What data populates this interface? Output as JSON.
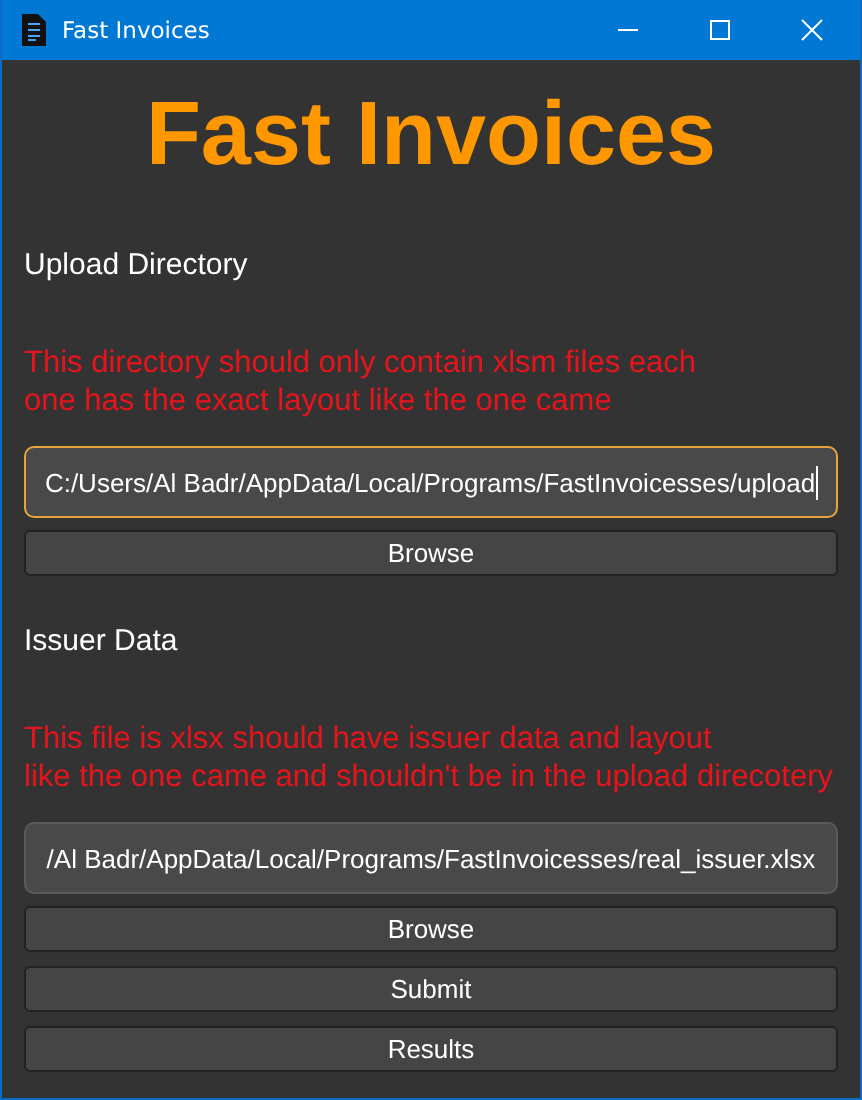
{
  "window": {
    "title": "Fast Invoices"
  },
  "heading": "Fast Invoices",
  "sections": [
    {
      "label": "Upload Directory",
      "note": "This directory should only contain xlsm files each\none has the exact layout like the one came",
      "field": {
        "value": "C:/Users/Al Badr/AppData/Local/Programs/FastInvoicesses/upload",
        "focused": true
      },
      "buttons": [
        "Browse"
      ]
    },
    {
      "label": "Issuer Data",
      "note": "This file is xlsx should have issuer data and layout\nlike the one came  and shouldn't be in the upload direcotery",
      "field": {
        "value": "/Al Badr/AppData/Local/Programs/FastInvoicesses/real_issuer.xlsx",
        "focused": false
      },
      "buttons": [
        "Browse",
        "Submit",
        "Results"
      ]
    }
  ]
}
